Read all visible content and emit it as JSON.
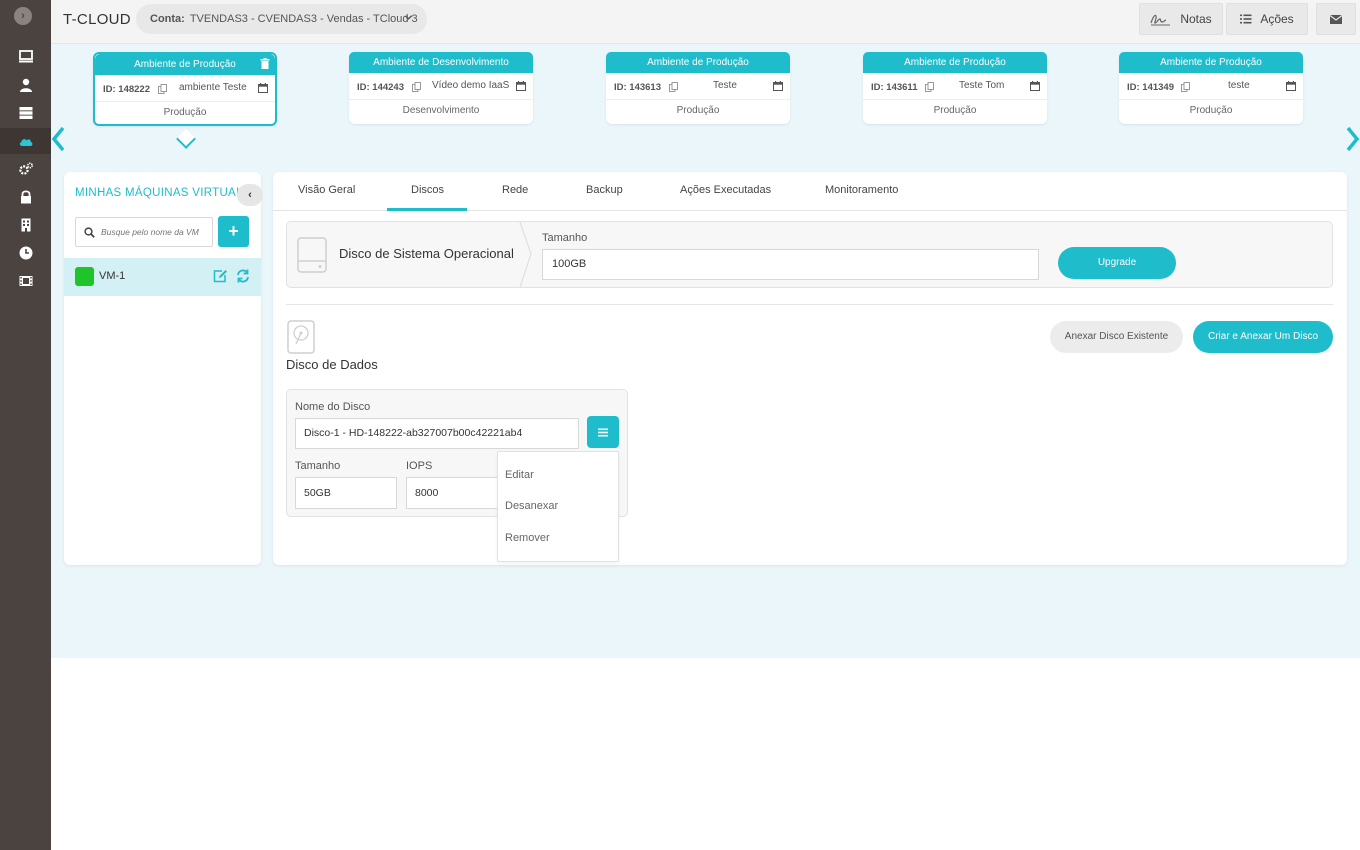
{
  "app": {
    "brand": "T-CLOUD",
    "account_label": "Conta:",
    "account_value": "TVENDAS3 - CVENDAS3 - Vendas - TCloud 3"
  },
  "topbar": {
    "notas_label": "Notas",
    "acoes_label": "Ações"
  },
  "sidebar": {
    "items": [
      "monitor-icon",
      "user-icon",
      "server-icon",
      "cloud-icon",
      "cogs-icon",
      "lock-icon",
      "building-icon",
      "clock-icon",
      "film-icon"
    ],
    "active_index": 3
  },
  "environments": [
    {
      "header": "Ambiente de Produção",
      "id": "ID: 148222",
      "name": "ambiente Teste",
      "type": "Produção",
      "selected": true
    },
    {
      "header": "Ambiente de Desenvolvimento",
      "id": "ID: 144243",
      "name": "Vídeo demo IaaS",
      "type": "Desenvolvimento",
      "selected": false
    },
    {
      "header": "Ambiente de Produção",
      "id": "ID: 143613",
      "name": "Teste",
      "type": "Produção",
      "selected": false
    },
    {
      "header": "Ambiente de Produção",
      "id": "ID: 143611",
      "name": "Teste Tom",
      "type": "Produção",
      "selected": false
    },
    {
      "header": "Ambiente de Produção",
      "id": "ID: 141349",
      "name": "teste",
      "type": "Produção",
      "selected": false
    }
  ],
  "vm_panel": {
    "title": "MINHAS MÁQUINAS VIRTUAIS",
    "collapse_label": "‹",
    "search_placeholder": "Busque pelo nome da VM",
    "add_label": "+",
    "vms": [
      {
        "name": "VM-1",
        "status_color": "#1fc42a"
      }
    ]
  },
  "tabs": [
    "Visão Geral",
    "Discos",
    "Rede",
    "Backup",
    "Ações Executadas",
    "Monitoramento"
  ],
  "active_tab": "Discos",
  "os_disk": {
    "title": "Disco de Sistema Operacional",
    "size_label": "Tamanho",
    "size_value": "100GB",
    "upgrade_label": "Upgrade"
  },
  "data_disks": {
    "title": "Disco de Dados",
    "attach_existing_label": "Anexar Disco Existente",
    "create_attach_label": "Criar e Anexar Um Disco",
    "disk": {
      "name_label": "Nome do Disco",
      "name_value": "Disco-1 - HD-148222-ab327007b00c42221ab4",
      "size_label": "Tamanho",
      "size_value": "50GB",
      "iops_label": "IOPS",
      "iops_value": "8000"
    },
    "menu": [
      "Editar",
      "Desanexar",
      "Remover"
    ]
  },
  "colors": {
    "accent": "#1fbccb",
    "sidebar": "#4a4340",
    "band": "#eaf6fa",
    "vm_selected": "#d3f0f4"
  }
}
